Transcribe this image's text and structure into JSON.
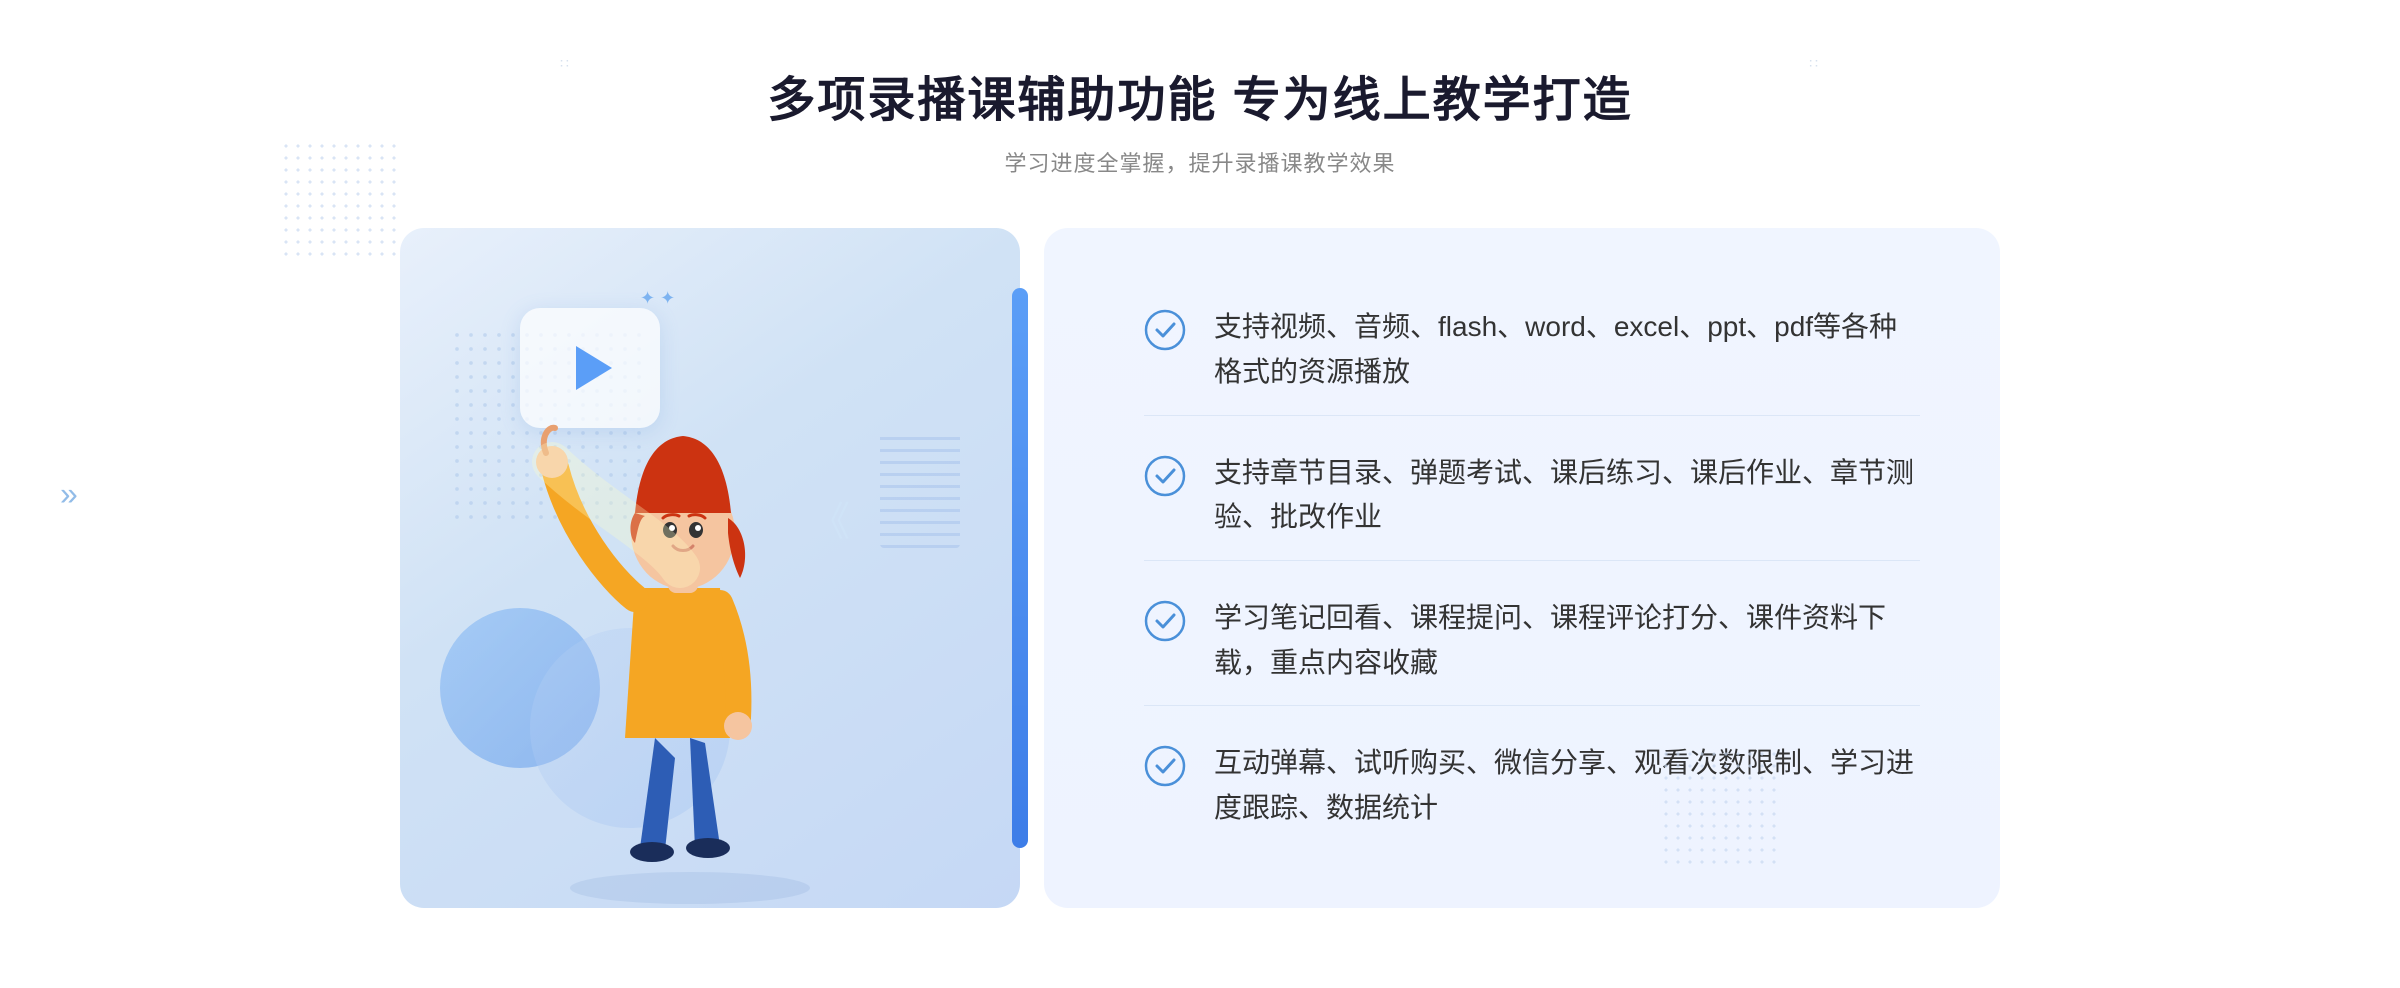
{
  "header": {
    "title": "多项录播课辅助功能 专为线上教学打造",
    "subtitle": "学习进度全掌握，提升录播课教学效果",
    "title_deco_left": "∷",
    "title_deco_right": "∷"
  },
  "features": [
    {
      "id": 1,
      "text": "支持视频、音频、flash、word、excel、ppt、pdf等各种格式的资源播放"
    },
    {
      "id": 2,
      "text": "支持章节目录、弹题考试、课后练习、课后作业、章节测验、批改作业"
    },
    {
      "id": 3,
      "text": "学习笔记回看、课程提问、课程评论打分、课件资料下载，重点内容收藏"
    },
    {
      "id": 4,
      "text": "互动弹幕、试听购买、微信分享、观看次数限制、学习进度跟踪、数据统计"
    }
  ],
  "colors": {
    "accent_blue": "#3d7de8",
    "light_blue": "#5b9ef7",
    "bg_light": "#f0f5ff",
    "text_dark": "#1a1a2e",
    "text_gray": "#888888"
  },
  "chevron_left_symbol": "»",
  "play_button_label": "▶"
}
